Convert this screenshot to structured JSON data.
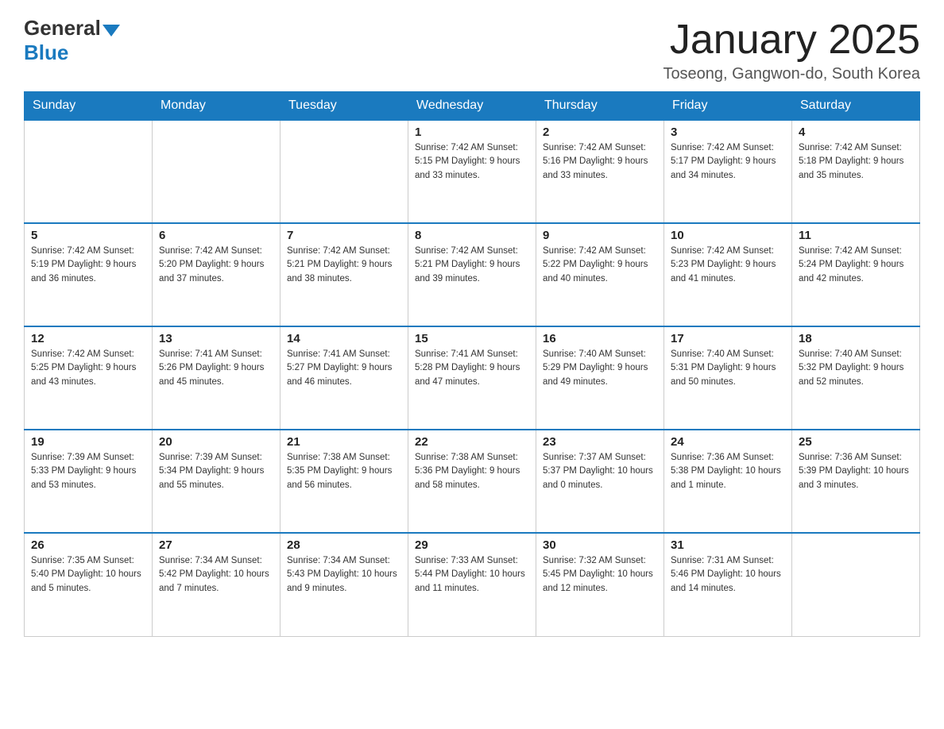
{
  "header": {
    "logo_general": "General",
    "logo_blue": "Blue",
    "month_title": "January 2025",
    "location": "Toseong, Gangwon-do, South Korea"
  },
  "days_of_week": [
    "Sunday",
    "Monday",
    "Tuesday",
    "Wednesday",
    "Thursday",
    "Friday",
    "Saturday"
  ],
  "weeks": [
    [
      {
        "day": "",
        "info": ""
      },
      {
        "day": "",
        "info": ""
      },
      {
        "day": "",
        "info": ""
      },
      {
        "day": "1",
        "info": "Sunrise: 7:42 AM\nSunset: 5:15 PM\nDaylight: 9 hours and 33 minutes."
      },
      {
        "day": "2",
        "info": "Sunrise: 7:42 AM\nSunset: 5:16 PM\nDaylight: 9 hours and 33 minutes."
      },
      {
        "day": "3",
        "info": "Sunrise: 7:42 AM\nSunset: 5:17 PM\nDaylight: 9 hours and 34 minutes."
      },
      {
        "day": "4",
        "info": "Sunrise: 7:42 AM\nSunset: 5:18 PM\nDaylight: 9 hours and 35 minutes."
      }
    ],
    [
      {
        "day": "5",
        "info": "Sunrise: 7:42 AM\nSunset: 5:19 PM\nDaylight: 9 hours and 36 minutes."
      },
      {
        "day": "6",
        "info": "Sunrise: 7:42 AM\nSunset: 5:20 PM\nDaylight: 9 hours and 37 minutes."
      },
      {
        "day": "7",
        "info": "Sunrise: 7:42 AM\nSunset: 5:21 PM\nDaylight: 9 hours and 38 minutes."
      },
      {
        "day": "8",
        "info": "Sunrise: 7:42 AM\nSunset: 5:21 PM\nDaylight: 9 hours and 39 minutes."
      },
      {
        "day": "9",
        "info": "Sunrise: 7:42 AM\nSunset: 5:22 PM\nDaylight: 9 hours and 40 minutes."
      },
      {
        "day": "10",
        "info": "Sunrise: 7:42 AM\nSunset: 5:23 PM\nDaylight: 9 hours and 41 minutes."
      },
      {
        "day": "11",
        "info": "Sunrise: 7:42 AM\nSunset: 5:24 PM\nDaylight: 9 hours and 42 minutes."
      }
    ],
    [
      {
        "day": "12",
        "info": "Sunrise: 7:42 AM\nSunset: 5:25 PM\nDaylight: 9 hours and 43 minutes."
      },
      {
        "day": "13",
        "info": "Sunrise: 7:41 AM\nSunset: 5:26 PM\nDaylight: 9 hours and 45 minutes."
      },
      {
        "day": "14",
        "info": "Sunrise: 7:41 AM\nSunset: 5:27 PM\nDaylight: 9 hours and 46 minutes."
      },
      {
        "day": "15",
        "info": "Sunrise: 7:41 AM\nSunset: 5:28 PM\nDaylight: 9 hours and 47 minutes."
      },
      {
        "day": "16",
        "info": "Sunrise: 7:40 AM\nSunset: 5:29 PM\nDaylight: 9 hours and 49 minutes."
      },
      {
        "day": "17",
        "info": "Sunrise: 7:40 AM\nSunset: 5:31 PM\nDaylight: 9 hours and 50 minutes."
      },
      {
        "day": "18",
        "info": "Sunrise: 7:40 AM\nSunset: 5:32 PM\nDaylight: 9 hours and 52 minutes."
      }
    ],
    [
      {
        "day": "19",
        "info": "Sunrise: 7:39 AM\nSunset: 5:33 PM\nDaylight: 9 hours and 53 minutes."
      },
      {
        "day": "20",
        "info": "Sunrise: 7:39 AM\nSunset: 5:34 PM\nDaylight: 9 hours and 55 minutes."
      },
      {
        "day": "21",
        "info": "Sunrise: 7:38 AM\nSunset: 5:35 PM\nDaylight: 9 hours and 56 minutes."
      },
      {
        "day": "22",
        "info": "Sunrise: 7:38 AM\nSunset: 5:36 PM\nDaylight: 9 hours and 58 minutes."
      },
      {
        "day": "23",
        "info": "Sunrise: 7:37 AM\nSunset: 5:37 PM\nDaylight: 10 hours and 0 minutes."
      },
      {
        "day": "24",
        "info": "Sunrise: 7:36 AM\nSunset: 5:38 PM\nDaylight: 10 hours and 1 minute."
      },
      {
        "day": "25",
        "info": "Sunrise: 7:36 AM\nSunset: 5:39 PM\nDaylight: 10 hours and 3 minutes."
      }
    ],
    [
      {
        "day": "26",
        "info": "Sunrise: 7:35 AM\nSunset: 5:40 PM\nDaylight: 10 hours and 5 minutes."
      },
      {
        "day": "27",
        "info": "Sunrise: 7:34 AM\nSunset: 5:42 PM\nDaylight: 10 hours and 7 minutes."
      },
      {
        "day": "28",
        "info": "Sunrise: 7:34 AM\nSunset: 5:43 PM\nDaylight: 10 hours and 9 minutes."
      },
      {
        "day": "29",
        "info": "Sunrise: 7:33 AM\nSunset: 5:44 PM\nDaylight: 10 hours and 11 minutes."
      },
      {
        "day": "30",
        "info": "Sunrise: 7:32 AM\nSunset: 5:45 PM\nDaylight: 10 hours and 12 minutes."
      },
      {
        "day": "31",
        "info": "Sunrise: 7:31 AM\nSunset: 5:46 PM\nDaylight: 10 hours and 14 minutes."
      },
      {
        "day": "",
        "info": ""
      }
    ]
  ]
}
